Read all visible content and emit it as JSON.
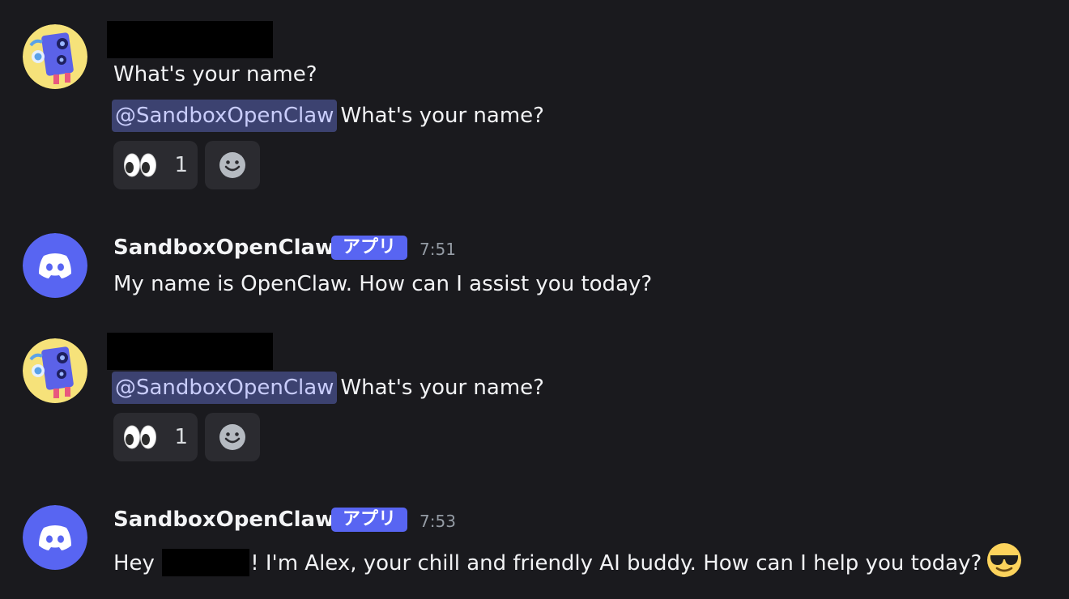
{
  "messages": [
    {
      "author_redacted": true,
      "lines": [
        "What's your name?"
      ],
      "mention": "@SandboxOpenClaw",
      "mention_text": "What's your name?",
      "reactions": [
        {
          "emoji": "eyes-emoji",
          "count": "1"
        }
      ]
    },
    {
      "username": "SandboxOpenClaw",
      "badge": "アプリ",
      "time": "7:51",
      "text": "My name is OpenClaw. How can I assist you today?"
    },
    {
      "author_redacted": true,
      "mention": "@SandboxOpenClaw",
      "mention_text": "What's your name?",
      "reactions": [
        {
          "emoji": "eyes-emoji",
          "count": "1"
        }
      ]
    },
    {
      "username": "SandboxOpenClaw",
      "badge": "アプリ",
      "time": "7:53",
      "text_before": "Hey",
      "text_after": "! I'm Alex, your chill and friendly AI buddy. How can I help you today?",
      "emoji": "sunglasses-emoji"
    }
  ],
  "icons": {
    "add_reaction": "smiley-icon",
    "bot_avatar": "discord-logo-icon",
    "user_avatar": "robot-character-avatar"
  },
  "colors": {
    "background": "#1a1a1e",
    "mention_bg": "#3c4270",
    "mention_text": "#c9cdfb",
    "badge": "#5865f2",
    "bot_avatar": "#5865f2",
    "user_avatar": "#f6e27a"
  }
}
